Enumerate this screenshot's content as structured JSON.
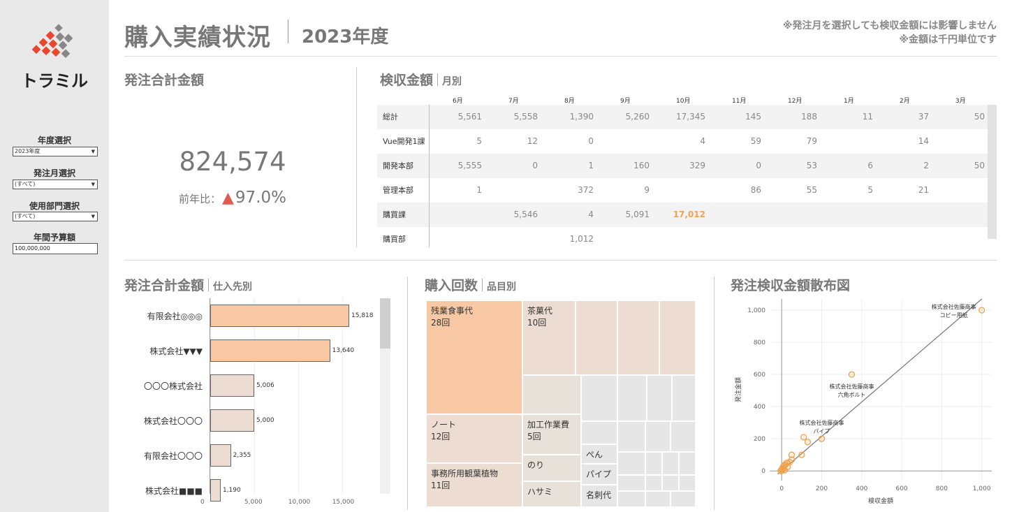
{
  "app": {
    "title": "購入実績状況",
    "fiscal_year": "2023年度",
    "notes": [
      "※発注月を選択しても検収金額には影響しません",
      "※金額は千円単位です"
    ]
  },
  "logo": {
    "text": "トラミル",
    "colors": {
      "red": "#e8462e",
      "gray": "#888888",
      "dark": "#222222"
    }
  },
  "filters": {
    "year": {
      "label": "年度選択",
      "value": "2023年度"
    },
    "month": {
      "label": "発注月選択",
      "value": "(すべて)"
    },
    "dept": {
      "label": "使用部門選択",
      "value": "(すべて)"
    },
    "budget": {
      "label": "年間予算額",
      "value": "100,000,000"
    }
  },
  "kpi": {
    "title": "発注合計金額",
    "value": "824,574",
    "yoy_label": "前年比：",
    "yoy_symbol": "▲",
    "yoy_value": "97.0%"
  },
  "monthly": {
    "title": "検収金額",
    "subtitle": "月別",
    "months": [
      "6月",
      "7月",
      "8月",
      "9月",
      "10月",
      "11月",
      "12月",
      "1月",
      "2月",
      "3月"
    ],
    "rows": [
      {
        "name": "総計",
        "values": [
          "5,561",
          "5,558",
          "1,390",
          "5,260",
          "17,345",
          "145",
          "188",
          "11",
          "37",
          "50"
        ]
      },
      {
        "name": "Vue開発1課",
        "values": [
          "5",
          "12",
          "0",
          "",
          "4",
          "59",
          "79",
          "",
          "14",
          ""
        ]
      },
      {
        "name": "開発本部",
        "values": [
          "5,555",
          "0",
          "1",
          "160",
          "329",
          "0",
          "53",
          "6",
          "2",
          "50"
        ]
      },
      {
        "name": "管理本部",
        "values": [
          "1",
          "",
          "372",
          "9",
          "",
          "86",
          "55",
          "5",
          "21",
          ""
        ]
      },
      {
        "name": "購買課",
        "values": [
          "",
          "5,546",
          "4",
          "5,091",
          "17,012",
          "",
          "",
          "",
          "",
          ""
        ]
      },
      {
        "name": "購買部",
        "values": [
          "",
          "",
          "1,012",
          "",
          "",
          "",
          "",
          "",
          "",
          ""
        ]
      }
    ],
    "highlight_color": "#f0a24e"
  },
  "supplier": {
    "title": "発注合計金額",
    "subtitle": "仕入先別",
    "chart_data": {
      "type": "bar",
      "orientation": "horizontal",
      "categories": [
        "有限会社◎◎◎",
        "株式会社▼▼▼",
        "〇〇〇株式会社",
        "株式会社〇〇〇",
        "有限会社〇〇〇",
        "株式会社■■■"
      ],
      "values": [
        15818,
        13640,
        5006,
        5000,
        2355,
        1190
      ],
      "labels": [
        "15,818",
        "13,640",
        "5,006",
        "5,000",
        "2,355",
        "1,190"
      ],
      "xticks": [
        "0",
        "5,000",
        "10,000",
        "15,000"
      ],
      "xlim": [
        0,
        19500
      ],
      "colors": {
        "high": "#f7c8a3",
        "low": "#eddcd1"
      }
    }
  },
  "items": {
    "title": "購入回数",
    "subtitle": "品目別",
    "tiles": [
      {
        "name": "残業食事代",
        "count": "28回",
        "color": "#f7c8a3"
      },
      {
        "name": "茶菓代",
        "count": "10回",
        "color": "#eddcd1"
      },
      {
        "name": "ノート",
        "count": "12回",
        "color": "#eddcd1"
      },
      {
        "name": "事務所用観葉植物",
        "count": "11回",
        "color": "#eddcd1"
      },
      {
        "name": "加工作業費",
        "count": "5回",
        "color": "#e8e1da"
      },
      {
        "name": "のり",
        "count": "",
        "color": "#e8e1da"
      },
      {
        "name": "ハサミ",
        "count": "",
        "color": "#e8e1da"
      },
      {
        "name": "ぺん",
        "count": "",
        "color": "#e6e6e6"
      },
      {
        "name": "パイプ",
        "count": "",
        "color": "#e6e6e6"
      },
      {
        "name": "名刺代",
        "count": "",
        "color": "#e6e6e6"
      }
    ]
  },
  "scatter": {
    "title": "発注検収金額散布図",
    "chart_data": {
      "type": "scatter",
      "xlabel": "検収金額",
      "ylabel": "発注金額",
      "xlim": [
        -60,
        1050
      ],
      "ylim": [
        -60,
        1070
      ],
      "xticks": [
        0,
        200,
        400,
        600,
        800,
        1000
      ],
      "yticks": [
        0,
        200,
        400,
        600,
        800,
        1000
      ],
      "tick_labels_x": [
        "0",
        "200",
        "400",
        "600",
        "800",
        "1,000"
      ],
      "tick_labels_y": [
        "0",
        "200",
        "400",
        "600",
        "800",
        "1,000"
      ],
      "points": [
        [
          1000,
          1000
        ],
        [
          350,
          600
        ],
        [
          200,
          200
        ],
        [
          110,
          210
        ],
        [
          130,
          180
        ],
        [
          100,
          100
        ],
        [
          50,
          100
        ],
        [
          50,
          70
        ],
        [
          40,
          55
        ],
        [
          20,
          40
        ],
        [
          10,
          30
        ],
        [
          5,
          20
        ],
        [
          0,
          10
        ],
        [
          15,
          5
        ],
        [
          30,
          25
        ],
        [
          2,
          2
        ],
        [
          8,
          12
        ],
        [
          25,
          50
        ],
        [
          -5,
          0
        ],
        [
          12,
          35
        ]
      ],
      "trendline": [
        [
          -20,
          -20
        ],
        [
          1000,
          1070
        ]
      ],
      "annotations": [
        {
          "x": 1000,
          "y": 1000,
          "lines": [
            "株式会社佐藤商事",
            "コピー用紙"
          ]
        },
        {
          "x": 350,
          "y": 600,
          "lines": [
            "株式会社佐藤商事",
            "六角ボルト"
          ]
        },
        {
          "x": 200,
          "y": 200,
          "lines": [
            "株式会社佐藤商事",
            "パイプ"
          ]
        }
      ],
      "point_color": "#f0a24e",
      "grid": true
    }
  }
}
